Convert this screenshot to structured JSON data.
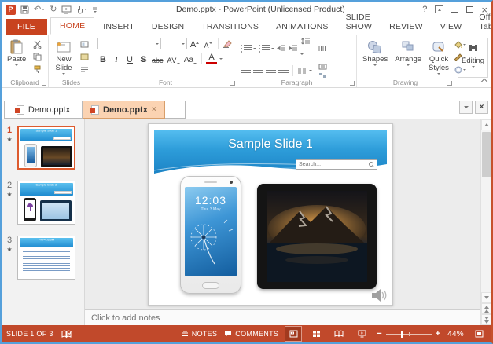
{
  "window": {
    "title": "Demo.pptx - PowerPoint (Unlicensed Product)",
    "help": "?",
    "minimize": "–",
    "close": "×"
  },
  "ribbon": {
    "tabs": [
      {
        "label": "FILE"
      },
      {
        "label": "HOME"
      },
      {
        "label": "INSERT"
      },
      {
        "label": "DESIGN"
      },
      {
        "label": "TRANSITIONS"
      },
      {
        "label": "ANIMATIONS"
      },
      {
        "label": "SLIDE SHOW"
      },
      {
        "label": "REVIEW"
      },
      {
        "label": "VIEW"
      },
      {
        "label": "Office Tab"
      }
    ],
    "clipboard": {
      "label": "Clipboard",
      "paste": "Paste"
    },
    "slides": {
      "label": "Slides",
      "new_slide": "New Slide"
    },
    "font": {
      "label": "Font",
      "bold": "B",
      "italic": "I",
      "underline": "U",
      "strike": "S",
      "strikethrough": "abc",
      "char_spacing": "AV",
      "change_case": "Aa",
      "font_color": "A",
      "grow_font": "A",
      "shrink_font": "A"
    },
    "paragraph": {
      "label": "Paragraph"
    },
    "drawing": {
      "label": "Drawing",
      "shapes": "Shapes",
      "arrange": "Arrange",
      "quick_styles": "Quick Styles"
    },
    "editing": {
      "label": "Editing"
    }
  },
  "doc_tabs": [
    {
      "label": "Demo.pptx"
    },
    {
      "label": "Demo.pptx",
      "close": "×"
    }
  ],
  "slides_panel": [
    {
      "number": "1"
    },
    {
      "number": "2"
    },
    {
      "number": "3"
    }
  ],
  "thumbs": {
    "t1_title": "Sample Slide 1",
    "t2_title": "Sample Slide 2",
    "t3_title": "FPPT.COM"
  },
  "slide": {
    "title": "Sample Slide 1",
    "search_placeholder": "Search...",
    "phone_time": "12:03",
    "phone_date": "Thu, 3 May"
  },
  "notes_placeholder": "Click to add notes",
  "status": {
    "slide_counter": "SLIDE 1 OF 3",
    "notes": "NOTES",
    "comments": "COMMENTS",
    "zoom": "44%"
  },
  "colors": {
    "accent": "#C8431F",
    "status_bar": "#C1492B",
    "active_doc_tab": "#FBD3B2",
    "window_border": "#55A0DB",
    "selection_border": "#DD5B2E"
  }
}
